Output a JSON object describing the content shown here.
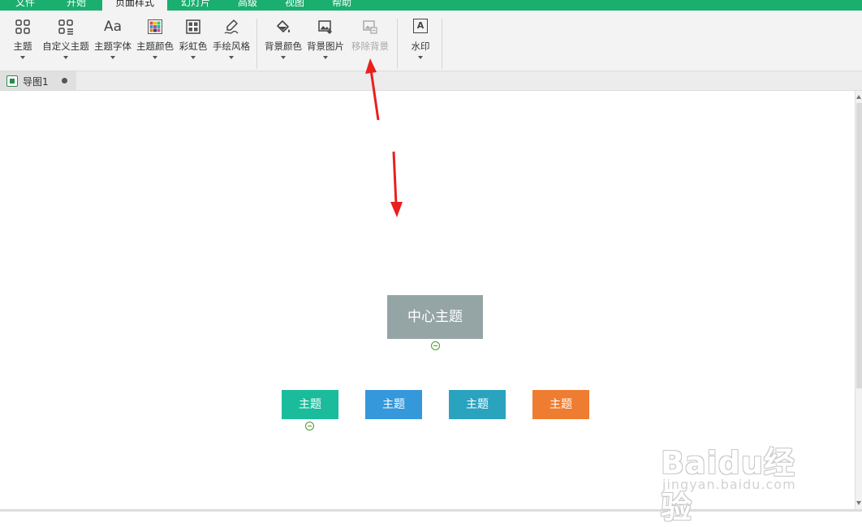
{
  "menu": {
    "tabs": [
      {
        "label": "文件"
      },
      {
        "label": "开始"
      },
      {
        "label": "页面样式"
      },
      {
        "label": "幻灯片"
      },
      {
        "label": "高级"
      },
      {
        "label": "视图"
      },
      {
        "label": "帮助"
      }
    ],
    "active_index": 2
  },
  "ribbon": {
    "buttons": [
      {
        "label": "主题",
        "icon": "grid-icon"
      },
      {
        "label": "自定义主题",
        "icon": "custom-grid-icon"
      },
      {
        "label": "主题字体",
        "icon": "font-icon",
        "glyph": "Aa"
      },
      {
        "label": "主题颜色",
        "icon": "color-palette-icon"
      },
      {
        "label": "彩虹色",
        "icon": "rainbow-icon"
      },
      {
        "label": "手绘风格",
        "icon": "pen-icon"
      },
      {
        "label": "背景颜色",
        "icon": "paint-bucket-icon"
      },
      {
        "label": "背景图片",
        "icon": "image-icon"
      },
      {
        "label": "移除背景",
        "icon": "remove-background-icon",
        "disabled": true
      },
      {
        "label": "水印",
        "icon": "watermark-icon",
        "glyph": "A"
      }
    ]
  },
  "tabs": {
    "document": "导图1"
  },
  "mindmap": {
    "central": {
      "text": "中心主题",
      "color": "#95a5a6"
    },
    "subtopics": [
      {
        "text": "主题",
        "color": "#1abc9c"
      },
      {
        "text": "主题",
        "color": "#3498db"
      },
      {
        "text": "主题",
        "color": "#2aa3bf"
      },
      {
        "text": "主题",
        "color": "#ef7d31"
      }
    ]
  },
  "watermark": {
    "brand": "Baidu经验",
    "url": "jingyan.baidu.com"
  },
  "colors": {
    "menubar": "#1aae6f",
    "arrow": "#e8201e"
  }
}
